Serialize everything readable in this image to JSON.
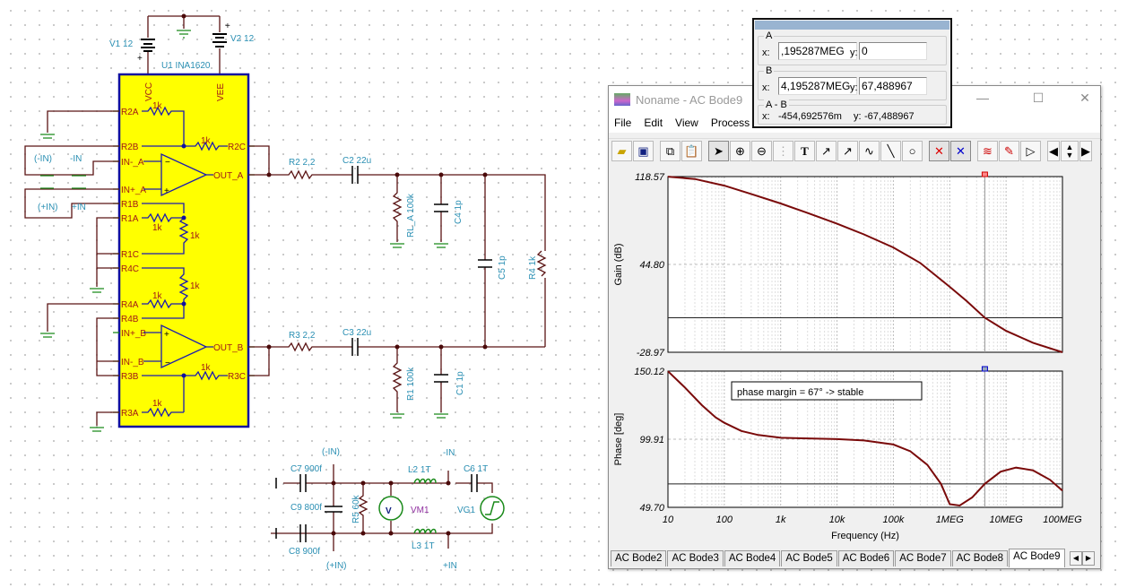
{
  "schematic": {
    "v1": "V1 12",
    "v2": "V2 12",
    "u1": "U1 INA1620",
    "vcc": "VCC",
    "vee": "VEE",
    "pins_left": [
      "R2A",
      "R2B",
      "IN-_A",
      "IN+_A",
      "R1B",
      "R1A",
      "R1C",
      "R4C",
      "R4A",
      "R4B",
      "IN+_B",
      "IN-_B",
      "R3B",
      "R3A"
    ],
    "pins_right": [
      "R2C",
      "OUT_A",
      "OUT_B",
      "R3C"
    ],
    "res_1k": "1k",
    "net_labels": {
      "neg_in_paren": "(-IN)",
      "neg_in": "-IN",
      "pos_in_paren": "(+IN)",
      "pos_in": "+IN"
    },
    "r2": "R2 2,2",
    "c2": "C2 22u",
    "rl_a": "RL_A 100k",
    "c4": "C4 1p",
    "c5": "C5 1p",
    "r4": "R4 1k",
    "r3": "R3 2,2",
    "c3": "C3 22u",
    "r1": "R1 100k",
    "c1": "C1 1p",
    "c7": "C7 900f",
    "c9": "C9 800f",
    "c8": "C8 900f",
    "r5": "R5 60k",
    "vm1": "VM1",
    "vm_glyph": "V",
    "l2": "L2 1T",
    "l3": "L3 1T",
    "c6": "C6 1T",
    "vg1": "VG1"
  },
  "cursor_panel": {
    "a": {
      "label": "A",
      "x_label": "x:",
      "x": ",195287MEG",
      "y_label": "y:",
      "y": "0"
    },
    "b": {
      "label": "B",
      "x_label": "x:",
      "x": "4,195287MEG",
      "y_label": "y:",
      "y": "67,488967"
    },
    "diff": {
      "label": "A - B",
      "x_label": "x:",
      "x": "-454,692576m",
      "y_label": "y:",
      "y": "-67,488967"
    }
  },
  "window": {
    "title": "Noname - AC Bode9",
    "minimize": "—",
    "maximize": "☐",
    "close": "✕",
    "menu": [
      "File",
      "Edit",
      "View",
      "Process"
    ],
    "toolbar": [
      "open-icon",
      "save-icon",
      "copy-icon",
      "paste-icon",
      "pointer-icon",
      "zoom-in-icon",
      "zoom-100-icon",
      "grid-icon",
      "text-icon",
      "label-icon",
      "query-icon",
      "formula-icon",
      "line-icon",
      "circle-icon",
      "cursor-a-icon",
      "cursor-b-icon",
      "add-curve-icon",
      "probe-icon",
      "marker-icon",
      "left-icon",
      "up-down-icon",
      "right-icon"
    ],
    "tabs": [
      "AC Bode2",
      "AC Bode3",
      "AC Bode4",
      "AC Bode5",
      "AC Bode6",
      "AC Bode7",
      "AC Bode8",
      "AC Bode9"
    ],
    "active_tab": "AC Bode9"
  },
  "chart_data": [
    {
      "type": "line",
      "ylabel": "Gain (dB)",
      "ylim": [
        -28.97,
        118.57
      ],
      "yticks": [
        "118.57",
        "44.80",
        "-28.97"
      ],
      "xscale": "log",
      "xlim": [
        10,
        100000000
      ],
      "reference_line": 0,
      "cursor_x": 4195287,
      "series": [
        {
          "color": "#7a0a0a",
          "x": [
            10,
            30,
            100,
            300,
            1000,
            3000,
            10000,
            30000,
            100000,
            300000,
            1000000,
            2000000,
            4195287,
            10000000,
            30000000,
            100000000
          ],
          "y": [
            118.5,
            116.5,
            111,
            104,
            96,
            88,
            79,
            70,
            59,
            46,
            26,
            14,
            0,
            -11,
            -21,
            -28.97
          ]
        }
      ]
    },
    {
      "type": "line",
      "ylabel": "Phase [deg]",
      "ylim": [
        49.7,
        150.12
      ],
      "yticks": [
        "150.12",
        "99.91",
        "49.70"
      ],
      "xscale": "log",
      "xlim": [
        10,
        100000000
      ],
      "reference_line": 67,
      "cursor_x": 4195287,
      "xticks": [
        "10",
        "100",
        "1k",
        "10k",
        "100k",
        "1MEG",
        "10MEG",
        "100MEG"
      ],
      "xlabel": "Frequency (Hz)",
      "annotation": "phase margin = 67° -> stable",
      "series": [
        {
          "color": "#7a0a0a",
          "x": [
            10,
            20,
            40,
            70,
            100,
            200,
            400,
            1000,
            3000,
            10000,
            30000,
            100000,
            200000,
            400000,
            700000,
            1000000,
            1500000,
            2500000,
            4195287,
            8000000,
            15000000,
            30000000,
            60000000,
            100000000
          ],
          "y": [
            150,
            138,
            125,
            116,
            112,
            106,
            103,
            101,
            100.5,
            100,
            99,
            96,
            91,
            81,
            67,
            52,
            51,
            57,
            67,
            76,
            79,
            77,
            70,
            62
          ]
        }
      ]
    }
  ]
}
